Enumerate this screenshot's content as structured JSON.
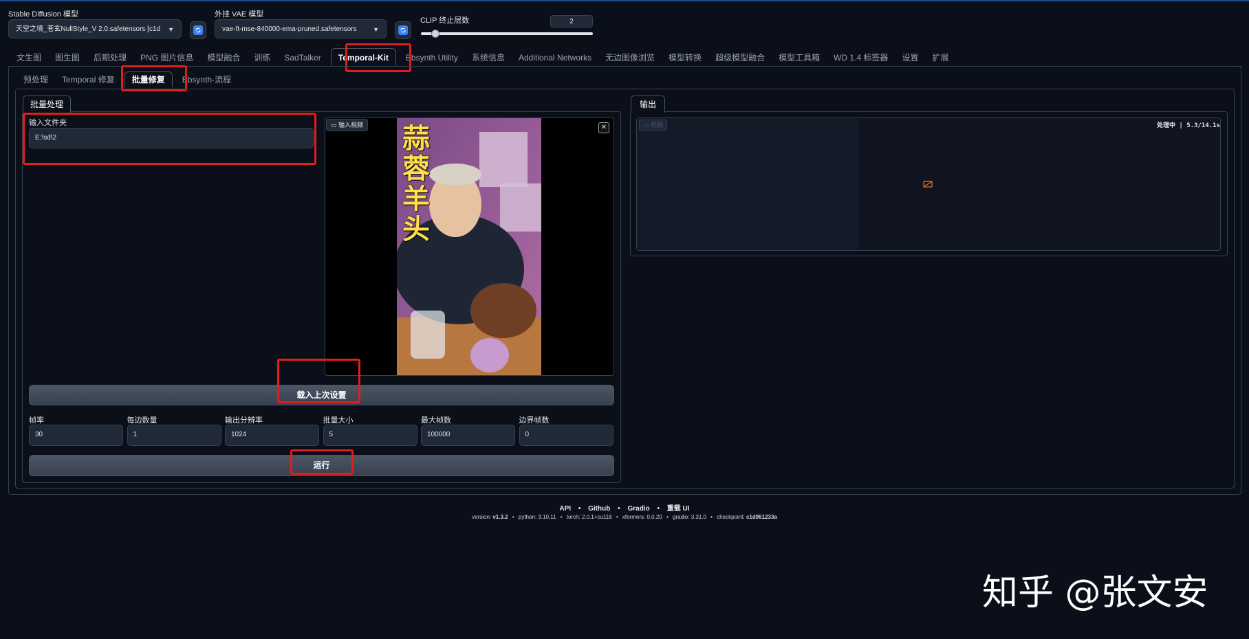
{
  "top": {
    "sd_model_label": "Stable Diffusion 模型",
    "sd_model_value": "天空之境_苍玄NullStyle_V 2.0.safetensors [c1d",
    "vae_label": "外挂 VAE 模型",
    "vae_value": "vae-ft-mse-840000-ema-pruned.safetensors",
    "clip_label": "CLIP 终止层数",
    "clip_value": "2",
    "clip_fraction": 0.083
  },
  "main_tabs": [
    "文生图",
    "图生图",
    "后期处理",
    "PNG 图片信息",
    "模型融合",
    "训练",
    "SadTalker",
    "Temporal-Kit",
    "Ebsynth Utility",
    "系统信息",
    "Additional Networks",
    "无边图像浏览",
    "模型转换",
    "超级模型融合",
    "模型工具箱",
    "WD 1.4 标签器",
    "设置",
    "扩展"
  ],
  "sub_tabs": [
    "预处理",
    "Temporal 修复",
    "批量修复",
    "Ebsynth-流程"
  ],
  "batch": {
    "panel_tab": "批量处理",
    "input_folder_label": "输入文件夹",
    "input_folder_value": "E:\\sd\\2",
    "video_label": "输入视频",
    "video_caption": "蒜蓉羊头",
    "load_button": "载入上次设置",
    "params": [
      {
        "label": "帧率",
        "value": "30"
      },
      {
        "label": "每边数量",
        "value": "1"
      },
      {
        "label": "输出分辨率",
        "value": "1024"
      },
      {
        "label": "批量大小",
        "value": "5"
      },
      {
        "label": "最大帧数",
        "value": "100000"
      },
      {
        "label": "边界帧数",
        "value": "0"
      }
    ],
    "run_button": "运行"
  },
  "output": {
    "tab": "输出",
    "video_label": "视频",
    "status": "处理中 | 5.3/14.1s"
  },
  "footer": {
    "links": [
      "API",
      "Github",
      "Gradio",
      "重载 UI"
    ],
    "version_prefix": "version: ",
    "version": "v1.3.2",
    "python": "python: 3.10.11",
    "torch": "torch: 2.0.1+cu118",
    "xformers": "xformers: 0.0.20",
    "gradio": "gradio: 3.31.0",
    "checkpoint_prefix": "checkpoint: ",
    "checkpoint": "c1d961233a"
  },
  "watermark": "知乎 @张文安",
  "colors": {
    "background": "#0b0f19",
    "accent_red": "#e11d1d",
    "panel_border": "#374151"
  }
}
